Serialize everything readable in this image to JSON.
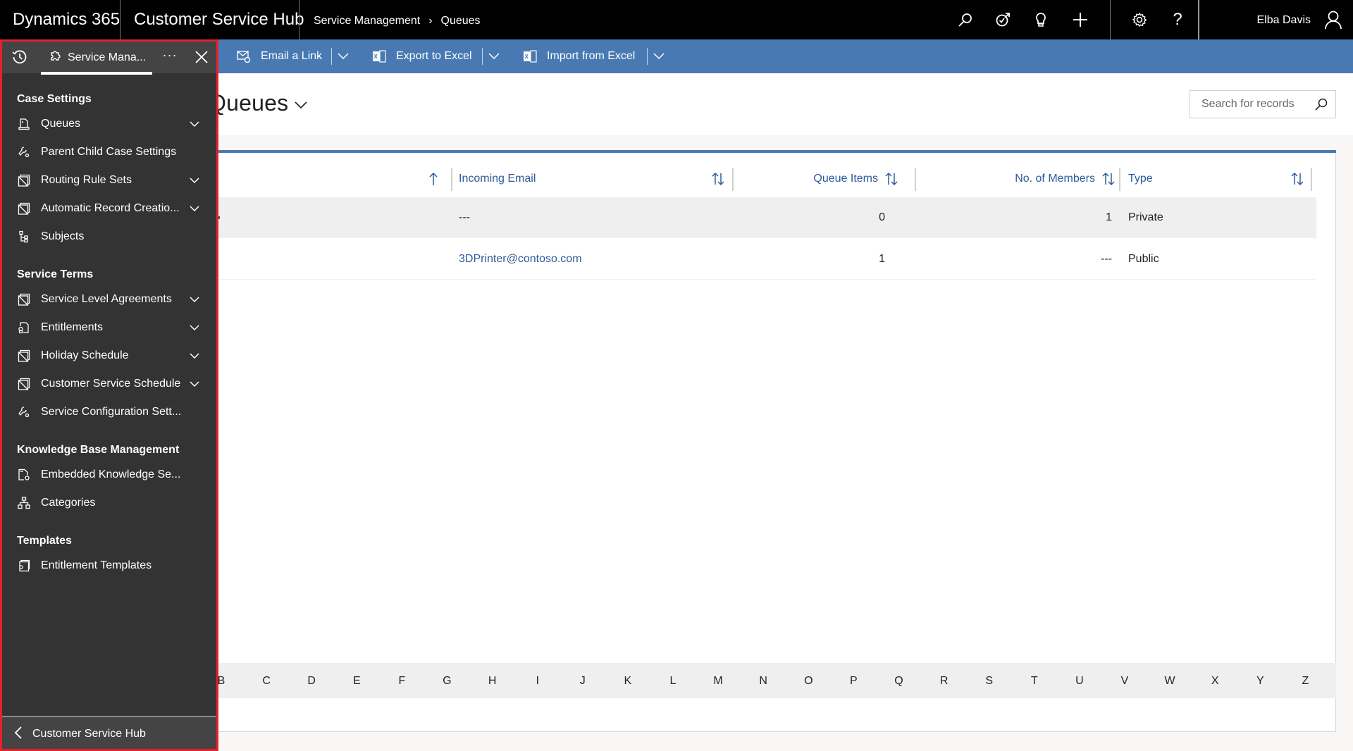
{
  "topbar": {
    "brand": "Dynamics 365",
    "app_name": "Customer Service Hub",
    "breadcrumb": [
      "Service Management",
      "Queues"
    ],
    "icons": [
      "search-icon",
      "task-flow-icon",
      "lightbulb-icon",
      "plus-icon",
      "gear-icon",
      "help-icon"
    ],
    "help_glyph": "?",
    "user_name": "Elba Davis"
  },
  "commandbar": {
    "items": [
      {
        "label": "Email a Link",
        "icon": "email-link-icon"
      },
      {
        "label": "Export to Excel",
        "icon": "excel-export-icon"
      },
      {
        "label": "Import from Excel",
        "icon": "excel-import-icon"
      }
    ]
  },
  "page": {
    "title": "Queues",
    "search_placeholder": "Search for records"
  },
  "grid": {
    "columns": [
      {
        "label": "",
        "sort": "ascending"
      },
      {
        "label": "Incoming Email",
        "sort": "none"
      },
      {
        "label": "Queue Items",
        "sort": "none"
      },
      {
        "label": "No. of Members",
        "sort": "none"
      },
      {
        "label": "Type",
        "sort": "none"
      }
    ],
    "rows": [
      {
        "incoming_email": "---",
        "queue_items": "0",
        "members": "1",
        "type": "Private",
        "selected": true
      },
      {
        "incoming_email": "3DPrinter@contoso.com",
        "queue_items": "1",
        "members": "---",
        "type": "Public",
        "selected": false
      }
    ],
    "alphabet": [
      "B",
      "C",
      "D",
      "E",
      "F",
      "G",
      "H",
      "I",
      "J",
      "K",
      "L",
      "M",
      "N",
      "O",
      "P",
      "Q",
      "R",
      "S",
      "T",
      "U",
      "V",
      "W",
      "X",
      "Y",
      "Z"
    ]
  },
  "sidebar": {
    "active_tab": "Service Mana...",
    "more_glyph": "···",
    "groups": [
      {
        "title": "Case Settings",
        "items": [
          {
            "label": "Queues",
            "icon": "queue-icon",
            "expandable": true
          },
          {
            "label": "Parent Child Case Settings",
            "icon": "settings-wrench-icon",
            "expandable": false
          },
          {
            "label": "Routing Rule Sets",
            "icon": "entity-icon",
            "expandable": true
          },
          {
            "label": "Automatic Record Creatio...",
            "icon": "entity-icon",
            "expandable": true
          },
          {
            "label": "Subjects",
            "icon": "tree-icon",
            "expandable": false
          }
        ]
      },
      {
        "title": "Service Terms",
        "items": [
          {
            "label": "Service Level Agreements",
            "icon": "entity-icon",
            "expandable": true
          },
          {
            "label": "Entitlements",
            "icon": "certificate-icon",
            "expandable": true
          },
          {
            "label": "Holiday Schedule",
            "icon": "entity-icon",
            "expandable": true
          },
          {
            "label": "Customer Service Schedule",
            "icon": "entity-icon",
            "expandable": true
          },
          {
            "label": "Service Configuration Sett...",
            "icon": "settings-wrench-icon",
            "expandable": false
          }
        ]
      },
      {
        "title": "Knowledge Base Management",
        "items": [
          {
            "label": "Embedded Knowledge Se...",
            "icon": "document-settings-icon",
            "expandable": false
          },
          {
            "label": "Categories",
            "icon": "hierarchy-icon",
            "expandable": false
          }
        ]
      },
      {
        "title": "Templates",
        "items": [
          {
            "label": "Entitlement Templates",
            "icon": "certificate-template-icon",
            "expandable": false
          }
        ]
      }
    ],
    "footer_label": "Customer Service Hub"
  },
  "colors": {
    "topbar_bg": "#000000",
    "commandbar_bg": "#4879b2",
    "sidebar_bg": "#333333",
    "highlight_border": "#e8202a",
    "link": "#2d5b9a"
  }
}
